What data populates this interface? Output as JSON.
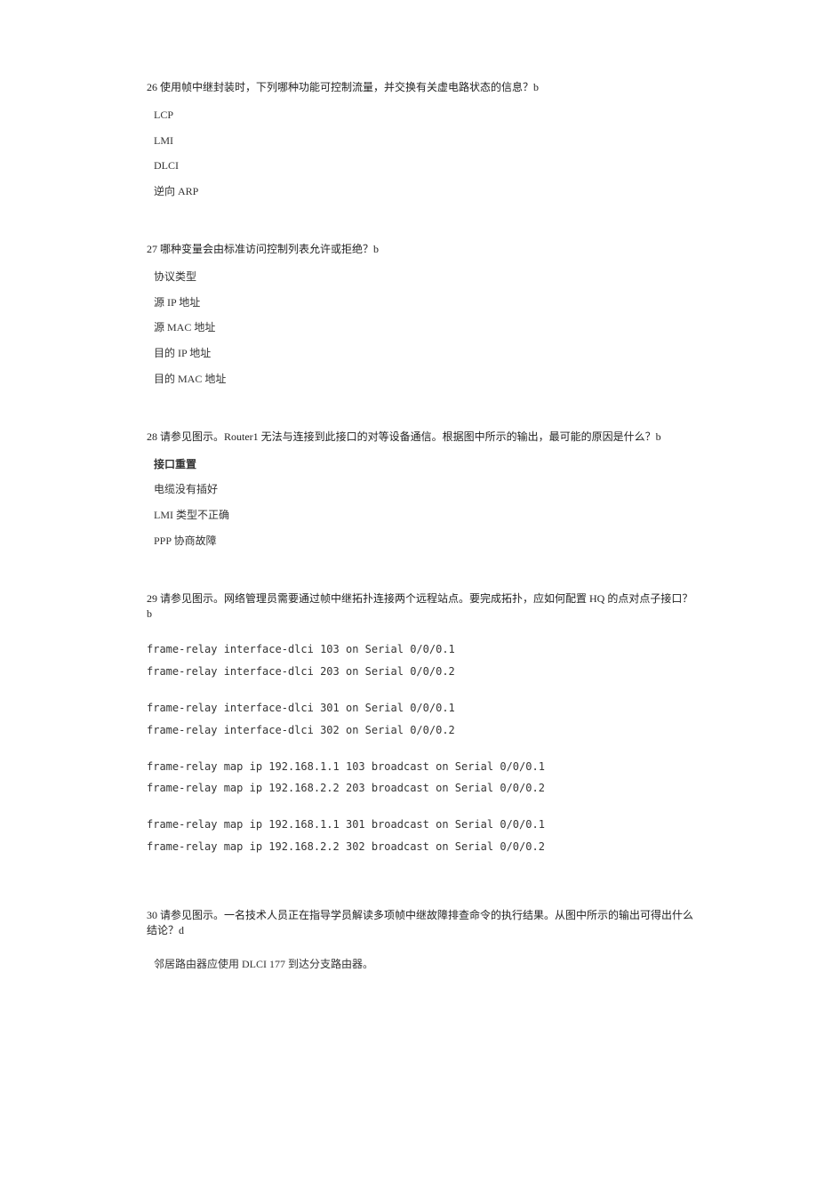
{
  "q26": {
    "title": "26 使用帧中继封装时，下列哪种功能可控制流量，并交换有关虚电路状态的信息？b",
    "opts": [
      "LCP",
      "LMI",
      "DLCI",
      "逆向 ARP"
    ]
  },
  "q27": {
    "title": "27 哪种变量会由标准访问控制列表允许或拒绝？b",
    "opts": [
      "协议类型",
      "源 IP 地址",
      "源 MAC 地址",
      "目的 IP 地址",
      "目的 MAC 地址"
    ]
  },
  "q28": {
    "title": "28 请参见图示。Router1 无法与连接到此接口的对等设备通信。根据图中所示的输出，最可能的原因是什么？b",
    "opts": [
      "接口重置",
      "电缆没有插好",
      "LMI 类型不正确",
      "PPP 协商故障"
    ]
  },
  "q29": {
    "title": "29 请参见图示。网络管理员需要通过帧中继拓扑连接两个远程站点。要完成拓扑，应如何配置 HQ 的点对点子接口？b",
    "groups": [
      [
        "frame-relay interface-dlci 103 on Serial 0/0/0.1",
        "frame-relay interface-dlci 203 on Serial 0/0/0.2"
      ],
      [
        "frame-relay interface-dlci 301 on Serial 0/0/0.1",
        "frame-relay interface-dlci 302 on Serial 0/0/0.2"
      ],
      [
        "frame-relay map ip 192.168.1.1 103 broadcast on Serial 0/0/0.1",
        "frame-relay map ip 192.168.2.2 203 broadcast on Serial 0/0/0.2"
      ],
      [
        "frame-relay map ip 192.168.1.1 301 broadcast on Serial 0/0/0.1",
        "frame-relay map ip 192.168.2.2 302 broadcast on Serial 0/0/0.2"
      ]
    ]
  },
  "q30": {
    "title": "30 请参见图示。一名技术人员正在指导学员解读多项帧中继故障排查命令的执行结果。从图中所示的输出可得出什么结论？d",
    "sub": "邻居路由器应使用 DLCI 177 到达分支路由器。"
  }
}
